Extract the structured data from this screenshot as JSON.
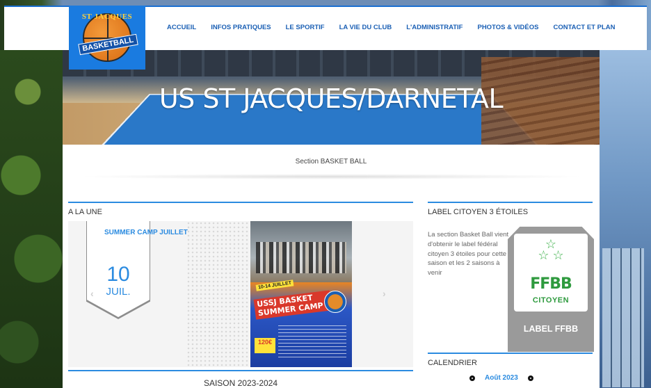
{
  "logo": {
    "top_text": "ST JACQUES",
    "main_text": "BASKETBALL"
  },
  "nav": {
    "items": [
      {
        "label": "ACCUEIL"
      },
      {
        "label": "INFOS PRATIQUES"
      },
      {
        "label": "LE SPORTIF"
      },
      {
        "label": "LA VIE DU CLUB"
      },
      {
        "label": "L'ADMINISTRATIF"
      },
      {
        "label": "PHOTOS & VIDÉOS"
      },
      {
        "label": "CONTACT ET PLAN"
      }
    ]
  },
  "hero": {
    "title": "US ST JACQUES/DARNETAL"
  },
  "subtitle": "Section BASKET BALL",
  "a_la_une": {
    "heading": "A LA UNE",
    "event": {
      "title": "SUMMER CAMP JUILLET",
      "day": "10",
      "month": "JUIL."
    },
    "poster": {
      "dates": "10-14 JUILLET",
      "title_line1": "USSJ BASKET",
      "title_line2": "SUMMER CAMP",
      "price": "120€"
    },
    "prev_arrow": "‹",
    "next_arrow": "›"
  },
  "label_citoyen": {
    "heading": "LABEL CITOYEN 3 ÉTOILES",
    "text": "La section Basket Ball vient d'obtenir le label fédéral citoyen 3 étoiles pour cette saison et les 2 saisons à venir",
    "badge_word": "FFBB",
    "badge_sub": "CITOYEN",
    "badge_label": "LABEL FFBB"
  },
  "calendrier": {
    "heading": "CALENDRIER",
    "month": "Août 2023"
  },
  "saison": {
    "heading": "SAISON 2023-2024"
  },
  "colors": {
    "accent": "#2b8be0",
    "nav_text": "#1a5fb4",
    "logo_bg": "#1a7be0",
    "ffbb_green": "#2e9a3e"
  }
}
